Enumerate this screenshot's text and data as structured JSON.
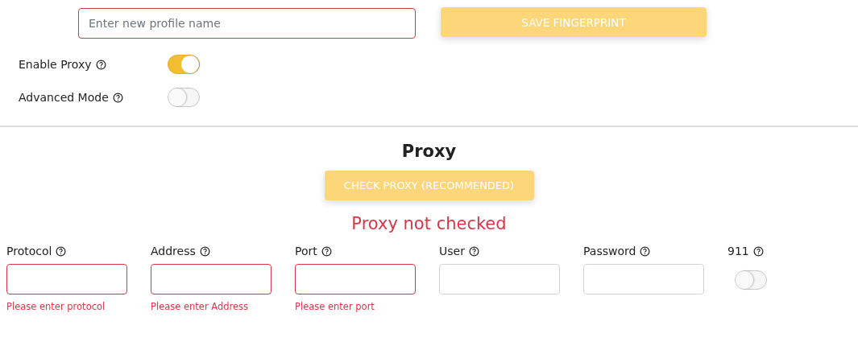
{
  "profile": {
    "placeholder": "Enter new profile name",
    "invalid": true
  },
  "save_button": {
    "label": "SAVE FINGERPRINT"
  },
  "settings": [
    {
      "label": "Enable Proxy",
      "on": true
    },
    {
      "label": "Advanced Mode",
      "on": false
    }
  ],
  "proxy": {
    "title": "Proxy",
    "check_button": "CHECK PROXY (RECOMMENDED)",
    "status": "Proxy not checked",
    "fields": [
      {
        "kind": "input",
        "label": "Protocol",
        "invalid": true,
        "error": "Please enter protocol"
      },
      {
        "kind": "input",
        "label": "Address",
        "invalid": true,
        "error": "Please enter Address"
      },
      {
        "kind": "input",
        "label": "Port",
        "invalid": true,
        "error": "Please enter port"
      },
      {
        "kind": "input",
        "label": "User",
        "invalid": false
      },
      {
        "kind": "input",
        "label": "Password",
        "invalid": false
      },
      {
        "kind": "toggle",
        "label": "911",
        "on": false
      }
    ]
  }
}
